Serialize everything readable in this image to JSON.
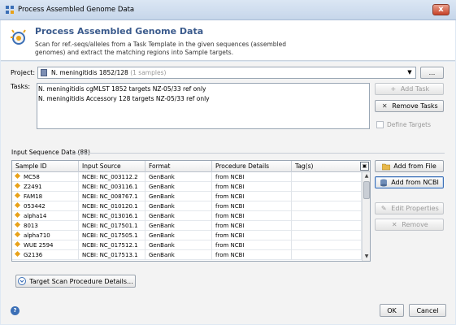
{
  "window": {
    "title": "Process Assembled Genome Data",
    "close_label": "x"
  },
  "banner": {
    "heading": "Process Assembled Genome Data",
    "description": "Scan for ref.-seqs/alleles from a Task Template in the given sequences (assembled genomes) and extract the matching regions into Sample targets."
  },
  "project": {
    "label": "Project:",
    "value": "N. meningitidis 1852/128",
    "count": "(1 samples)",
    "browse_label": "..."
  },
  "tasks": {
    "label": "Tasks:",
    "items": [
      "N. meningitidis cgMLST 1852 targets NZ-05/33 ref only",
      "N. meningitidis Accessory 128 targets NZ-05/33 ref only"
    ],
    "add_label": "Add Task",
    "remove_label": "Remove Tasks",
    "define_targets_label": "Define Targets"
  },
  "input_sequences": {
    "title": "Input Sequence Data (88)",
    "columns": [
      "Sample ID",
      "Input Source",
      "Format",
      "Procedure Details",
      "Tag(s)"
    ],
    "rows": [
      [
        "MC58",
        "NCBI: NC_003112.2",
        "GenBank",
        "from NCBI",
        ""
      ],
      [
        "Z2491",
        "NCBI: NC_003116.1",
        "GenBank",
        "from NCBI",
        ""
      ],
      [
        "FAM18",
        "NCBI: NC_008767.1",
        "GenBank",
        "from NCBI",
        ""
      ],
      [
        "053442",
        "NCBI: NC_010120.1",
        "GenBank",
        "from NCBI",
        ""
      ],
      [
        "alpha14",
        "NCBI: NC_013016.1",
        "GenBank",
        "from NCBI",
        ""
      ],
      [
        "8013",
        "NCBI: NC_017501.1",
        "GenBank",
        "from NCBI",
        ""
      ],
      [
        "alpha710",
        "NCBI: NC_017505.1",
        "GenBank",
        "from NCBI",
        ""
      ],
      [
        "WUE 2594",
        "NCBI: NC_017512.1",
        "GenBank",
        "from NCBI",
        ""
      ],
      [
        "G2136",
        "NCBI: NC_017513.1",
        "GenBank",
        "from NCBI",
        ""
      ]
    ],
    "add_from_file_label": "Add from File",
    "add_from_ncbi_label": "Add from NCBI",
    "edit_properties_label": "Edit Properties",
    "remove_label": "Remove"
  },
  "footer": {
    "details_label": "Target Scan Procedure Details...",
    "ok_label": "OK",
    "cancel_label": "Cancel"
  }
}
